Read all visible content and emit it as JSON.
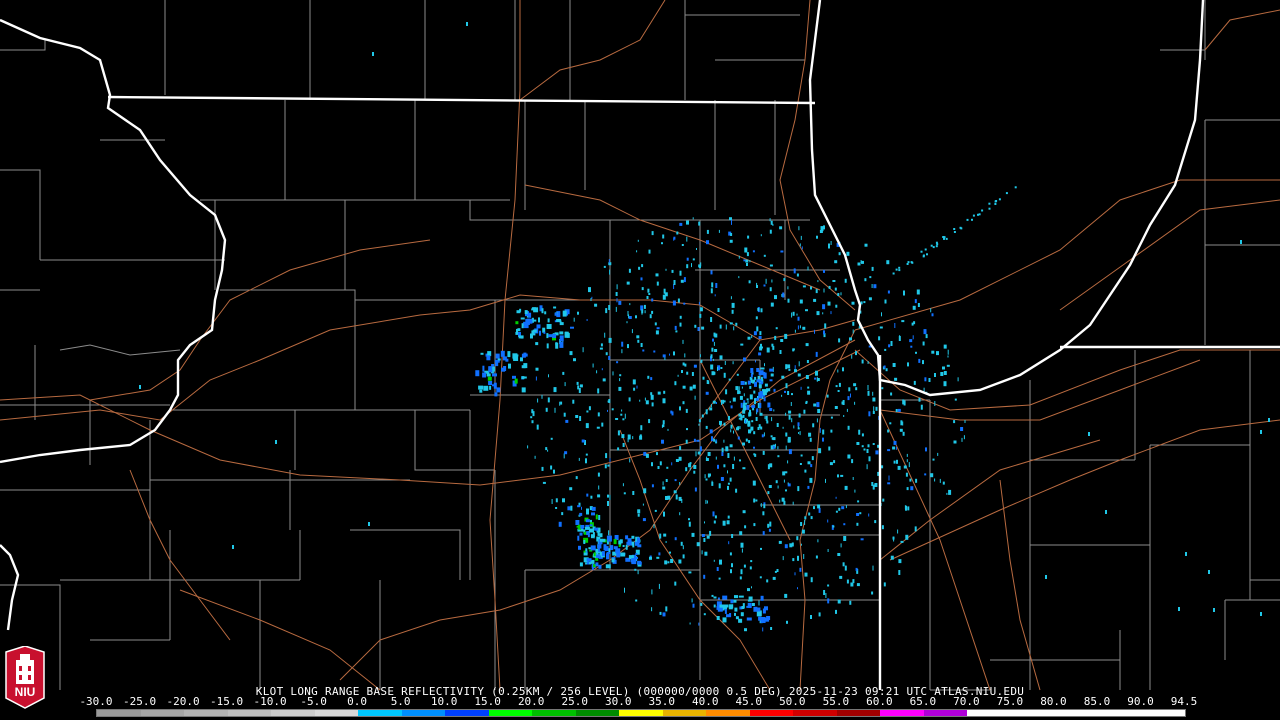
{
  "product_title": "KLOT LONG RANGE BASE REFLECTIVITY (0.25KM / 256 LEVEL) (000000/0000 0.5 DEG) 2025-11-23 09:21 UTC  ATLAS.NIU.EDU",
  "logo": {
    "text": "NIU",
    "icon": "university-tower-icon",
    "color": "#c8102e"
  },
  "scale": {
    "labels": [
      "-30.0",
      "-25.0",
      "-20.0",
      "-15.0",
      "-10.0",
      "-5.0",
      "0.0",
      "5.0",
      "10.0",
      "15.0",
      "20.0",
      "25.0",
      "30.0",
      "35.0",
      "40.0",
      "45.0",
      "50.0",
      "55.0",
      "60.0",
      "65.0",
      "70.0",
      "75.0",
      "80.0",
      "85.0",
      "90.0",
      "94.5"
    ],
    "colors": [
      "#9a9a9a",
      "#a6a6a6",
      "#b3b3b3",
      "#bfbfbf",
      "#cccccc",
      "#d9d9d9",
      "#00c8ff",
      "#0090ff",
      "#0040ff",
      "#00ff00",
      "#00c000",
      "#008c00",
      "#ffff00",
      "#e8b400",
      "#ff8c00",
      "#ff0000",
      "#d00000",
      "#a00000",
      "#ff00ff",
      "#b000d8",
      "#ffffff",
      "#ffffff",
      "#ffffff",
      "#ffffff",
      "#ffffff"
    ]
  },
  "map_colors": {
    "state_lines": "#ffffff",
    "county_lines": "#8c8c8c",
    "roads": "#b86a40",
    "echo_light": "#20c8e8",
    "echo_mid": "#1070ff",
    "echo_strong": "#00d000"
  }
}
